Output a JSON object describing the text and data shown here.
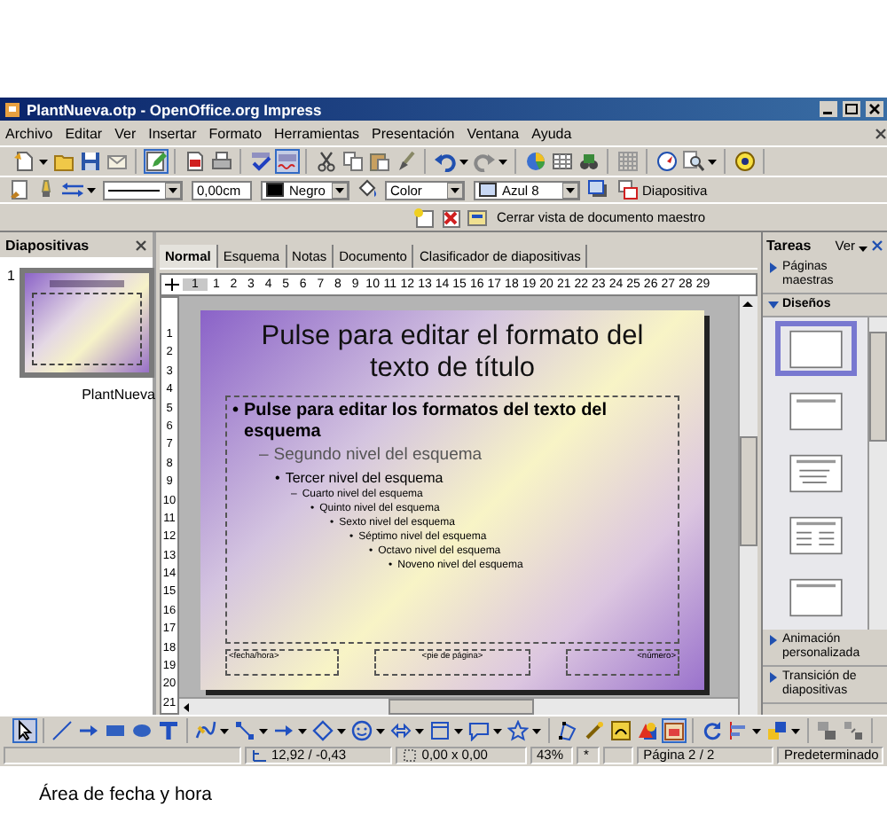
{
  "window": {
    "title": "PlantNueva.otp - OpenOffice.org Impress"
  },
  "menu": [
    "Archivo",
    "Editar",
    "Ver",
    "Insertar",
    "Formato",
    "Herramientas",
    "Presentación",
    "Ventana",
    "Ayuda"
  ],
  "standard_toolbar": [
    [
      {
        "kind": "new",
        "on": false
      },
      {
        "kind": "open",
        "on": false
      },
      {
        "kind": "save",
        "on": false
      },
      {
        "kind": "mail",
        "on": false
      }
    ],
    [
      {
        "kind": "edit",
        "on": true
      }
    ],
    [
      {
        "kind": "pdf",
        "on": false
      },
      {
        "kind": "print",
        "on": false
      }
    ],
    [
      {
        "kind": "spell",
        "on": false
      },
      {
        "kind": "autospell",
        "on": true
      }
    ],
    [
      {
        "kind": "cut",
        "on": false
      },
      {
        "kind": "copy",
        "on": false
      },
      {
        "kind": "paste",
        "on": false
      },
      {
        "kind": "brush",
        "on": false
      }
    ],
    [
      {
        "kind": "undo",
        "on": false
      },
      {
        "kind": "redo",
        "on": false
      }
    ],
    [
      {
        "kind": "chart",
        "on": false
      },
      {
        "kind": "table",
        "on": false
      },
      {
        "kind": "navigator",
        "on": false
      }
    ],
    [
      {
        "kind": "grid",
        "on": false
      }
    ],
    [
      {
        "kind": "compass",
        "on": false
      },
      {
        "kind": "zoom",
        "on": false
      }
    ],
    [
      {
        "kind": "help",
        "on": false
      }
    ]
  ],
  "line_toolbar": [
    {
      "kind": "styles"
    },
    {
      "kind": "linepen"
    },
    {
      "kind": "arrows"
    },
    {
      "kind": "line_style"
    },
    {
      "kind": "width",
      "value": "0,00cm"
    },
    {
      "kind": "line_color",
      "value": "Negro",
      "color": "#000000"
    },
    {
      "kind": "area"
    },
    {
      "kind": "fill_type",
      "value": "Color"
    },
    {
      "kind": "fill_color",
      "value": "Azul 8",
      "color": "#c8d8f4"
    },
    {
      "kind": "shadow"
    },
    {
      "kind": "slide",
      "value": "Diapositiva"
    }
  ],
  "master_toolbar": {
    "button": "Cerrar vista de documento maestro"
  },
  "slides_pane": {
    "title": "Diapositivas",
    "slides": [
      {
        "number": "1",
        "name": "PlantNueva",
        "selected": true
      }
    ]
  },
  "view_tabs": [
    {
      "label": "Normal",
      "selected": true
    },
    {
      "label": "Esquema",
      "selected": false
    },
    {
      "label": "Notas",
      "selected": false
    },
    {
      "label": "Documento",
      "selected": false
    },
    {
      "label": "Clasificador de diapositivas",
      "selected": false
    }
  ],
  "ruler": {
    "horizontal": [
      "1",
      "1",
      "2",
      "3",
      "4",
      "5",
      "6",
      "7",
      "8",
      "9",
      "10",
      "11",
      "12",
      "13",
      "14",
      "15",
      "16",
      "17",
      "18",
      "19",
      "20",
      "21",
      "22",
      "23",
      "24",
      "25",
      "26",
      "27",
      "28",
      "29"
    ],
    "vertical": [
      "1",
      "2",
      "3",
      "4",
      "5",
      "6",
      "7",
      "8",
      "9",
      "10",
      "11",
      "12",
      "13",
      "14",
      "15",
      "16",
      "17",
      "18",
      "19",
      "20",
      "21"
    ]
  },
  "slide": {
    "title": "Pulse para editar el formato del texto de título",
    "outline": [
      {
        "bullet": "•",
        "text": "Pulse para editar los formatos del texto del esquema",
        "children": [
          {
            "bullet": "–",
            "text": "Segundo nivel del esquema",
            "children": [
              {
                "bullet": "•",
                "text": "Tercer nivel del esquema",
                "children": [
                  {
                    "bullet": "–",
                    "text": "Cuarto nivel del esquema",
                    "children": [
                      {
                        "bullet": "•",
                        "text": "Quinto nivel del esquema",
                        "children": [
                          {
                            "bullet": "•",
                            "text": "Sexto nivel del esquema",
                            "children": [
                              {
                                "bullet": "•",
                                "text": "Séptimo nivel del esquema",
                                "children": [
                                  {
                                    "bullet": "•",
                                    "text": "Octavo nivel del esquema",
                                    "children": [
                                      {
                                        "bullet": "•",
                                        "text": "Noveno nivel del esquema"
                                      }
                                    ]
                                  }
                                ]
                              }
                            ]
                          }
                        ]
                      }
                    ]
                  }
                ]
              }
            ]
          }
        ]
      }
    ],
    "footer": [
      "<fecha/hora>",
      "<pie de página>",
      "<número>"
    ]
  },
  "tasks_pane": {
    "title": "Tareas",
    "view": "Ver",
    "sections": [
      {
        "label": "Páginas maestras",
        "expanded": false
      },
      {
        "label": "Diseños",
        "expanded": true
      },
      {
        "label": "Animación personalizada",
        "expanded": false
      },
      {
        "label": "Transición de diapositivas",
        "expanded": false
      }
    ],
    "layouts": [
      {
        "kind": "blank",
        "selected": true
      },
      {
        "kind": "title",
        "selected": false
      },
      {
        "kind": "list",
        "selected": false
      },
      {
        "kind": "columns",
        "selected": false
      },
      {
        "kind": "title_only",
        "selected": false
      }
    ]
  },
  "drawing_toolbar": [
    [
      {
        "kind": "select",
        "on": true
      }
    ],
    [
      {
        "kind": "line",
        "on": false
      },
      {
        "kind": "arrow",
        "on": false
      },
      {
        "kind": "rect",
        "on": false
      },
      {
        "kind": "ellipse",
        "on": false
      },
      {
        "kind": "text",
        "on": false
      }
    ],
    [
      {
        "kind": "curve",
        "on": false
      },
      {
        "kind": "connector",
        "on": false
      },
      {
        "kind": "lines",
        "on": false
      },
      {
        "kind": "basic",
        "on": false
      },
      {
        "kind": "symbol",
        "on": false
      },
      {
        "kind": "block",
        "on": false
      },
      {
        "kind": "flowchart",
        "on": false
      },
      {
        "kind": "callout",
        "on": false
      },
      {
        "kind": "stars",
        "on": false
      }
    ],
    [
      {
        "kind": "points",
        "on": false
      },
      {
        "kind": "glue",
        "on": false
      },
      {
        "kind": "fontwork",
        "on": false
      },
      {
        "kind": "shapes",
        "on": false
      },
      {
        "kind": "gallery",
        "on": true
      }
    ],
    [
      {
        "kind": "rotate",
        "on": false
      },
      {
        "kind": "align",
        "on": false
      },
      {
        "kind": "arrange",
        "on": false
      }
    ],
    [
      {
        "kind": "group",
        "on": false
      },
      {
        "kind": "ungroup",
        "on": false
      }
    ]
  ],
  "status_bar": [
    {
      "kind": "blank"
    },
    {
      "kind": "position",
      "text": "12,92 / -0,43"
    },
    {
      "kind": "size",
      "text": "0,00 x 0,00"
    },
    {
      "kind": "zoom",
      "text": "43%"
    },
    {
      "kind": "modified",
      "text": "*"
    },
    {
      "kind": "blank"
    },
    {
      "kind": "page",
      "text": "Página 2 / 2"
    },
    {
      "kind": "layout",
      "text": "Predeterminado"
    }
  ],
  "caption": "Área de fecha y hora"
}
